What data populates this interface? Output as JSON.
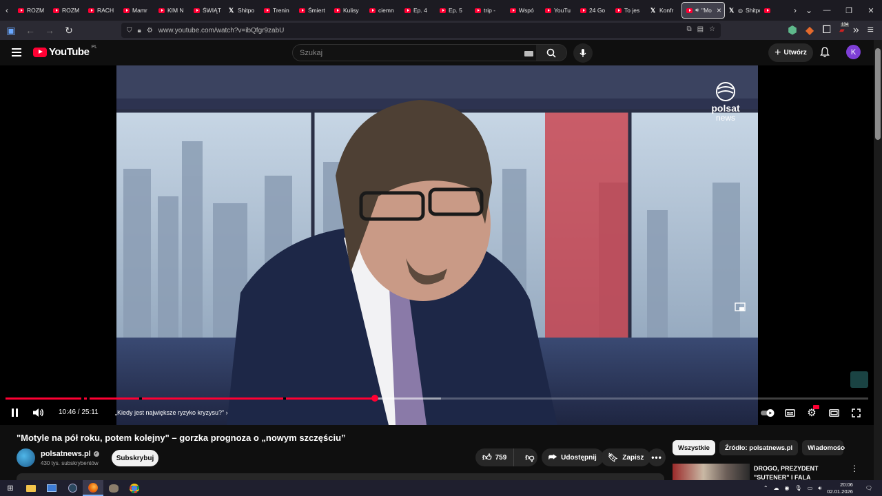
{
  "browser": {
    "tabs": [
      {
        "label": "ROZM",
        "icon": "youtube-icon"
      },
      {
        "label": "ROZM",
        "icon": "youtube-icon"
      },
      {
        "label": "RACH",
        "icon": "youtube-icon"
      },
      {
        "label": "Mamr",
        "icon": "youtube-icon"
      },
      {
        "label": "KIM N",
        "icon": "youtube-icon"
      },
      {
        "label": "ŚWIĄT",
        "icon": "youtube-icon"
      },
      {
        "label": "Shitpo",
        "icon": "x-icon"
      },
      {
        "label": "Trenin",
        "icon": "youtube-icon"
      },
      {
        "label": "Śmiert",
        "icon": "youtube-icon"
      },
      {
        "label": "Kulisy",
        "icon": "youtube-icon"
      },
      {
        "label": "ciemn",
        "icon": "youtube-icon"
      },
      {
        "label": "Ep. 4",
        "icon": "youtube-icon"
      },
      {
        "label": "Ep. 5",
        "icon": "youtube-icon"
      },
      {
        "label": "trip -",
        "icon": "youtube-icon"
      },
      {
        "label": "Wspó",
        "icon": "youtube-icon"
      },
      {
        "label": "YouTu",
        "icon": "youtube-icon"
      },
      {
        "label": "24 Go",
        "icon": "youtube-icon"
      },
      {
        "label": "To jes",
        "icon": "youtube-icon"
      },
      {
        "label": "Konfr",
        "icon": "x-icon"
      }
    ],
    "active_tab": {
      "label": "\"Mo"
    },
    "tab_after_active": {
      "label": "Shitpo"
    },
    "url": "www.youtube.com/watch?v=ibQfgr9zabU",
    "extension_badge": "134"
  },
  "youtube": {
    "logo_text": "YouTube",
    "logo_country": "PL",
    "search_placeholder": "Szukaj",
    "create_label": "Utwórz",
    "avatar_letter": "K"
  },
  "player": {
    "current_time": "10:46",
    "duration": "25:11",
    "time_separator": " / ",
    "chapter": "„Kiedy jest największe ryzyko kryzysu?”",
    "progress_fraction": 0.428,
    "brand_line1": "polsat",
    "brand_line2": "news"
  },
  "video": {
    "title": "\"Motyle na pół roku, potem kolejny\" – gorzka prognoza o „nowym szczęściu”",
    "channel": "polsatnews.pl",
    "subscribers": "430 tys. subskrybentów",
    "subscribe_label": "Subskrybuj",
    "likes": "759",
    "share_label": "Udostępnij",
    "save_label": "Zapisz"
  },
  "sidebar": {
    "chips": [
      "Wszystkie",
      "Źródło: polsatnews.pl",
      "Wiadomośc"
    ],
    "recommendation_title": "DROGO, PREZYDENT \"SUTENER\" I FALA UKRAIŃCÓ..."
  },
  "taskbar": {
    "time": "20:06",
    "date": "02.01.2026"
  }
}
